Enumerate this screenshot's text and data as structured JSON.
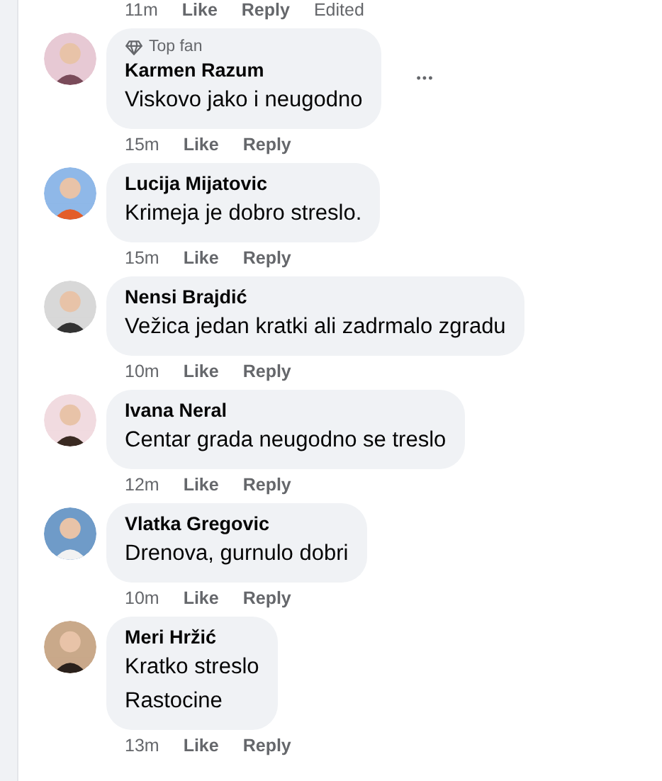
{
  "previous_actions": {
    "time": "11m",
    "like": "Like",
    "reply": "Reply",
    "edited": "Edited"
  },
  "comments": [
    {
      "badge": "Top fan",
      "author": "Karmen Razum",
      "lines": [
        "Viskovo jako i neugodno"
      ],
      "time": "15m",
      "like": "Like",
      "reply": "Reply",
      "more": "•••"
    },
    {
      "author": "Lucija Mijatovic",
      "lines": [
        "Krimeja je dobro streslo."
      ],
      "time": "15m",
      "like": "Like",
      "reply": "Reply"
    },
    {
      "author": "Nensi Brajdić",
      "lines": [
        "Vežica jedan kratki ali zadrmalo zgradu"
      ],
      "time": "10m",
      "like": "Like",
      "reply": "Reply"
    },
    {
      "author": "Ivana Neral",
      "lines": [
        "Centar grada neugodno se treslo"
      ],
      "time": "12m",
      "like": "Like",
      "reply": "Reply"
    },
    {
      "author": "Vlatka Gregovic",
      "lines": [
        "Drenova, gurnulo dobri"
      ],
      "time": "10m",
      "like": "Like",
      "reply": "Reply"
    },
    {
      "author": "Meri Hržić",
      "lines": [
        "Kratko streslo",
        "Rastocine"
      ],
      "time": "13m",
      "like": "Like",
      "reply": "Reply"
    }
  ]
}
